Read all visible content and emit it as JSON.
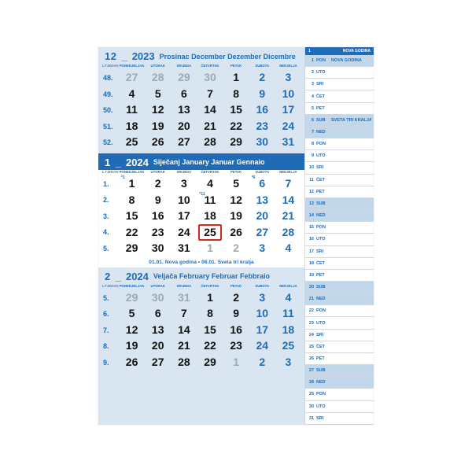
{
  "calendar": {
    "dow_labels": [
      "1.TJEDAN",
      "PONEDJELJAK",
      "UTORAK",
      "SRIJEDA",
      "ČETVRTAK",
      "PETAK",
      "SUBOTA",
      "NEDJELJA"
    ],
    "months": [
      {
        "num": "12",
        "sep": "_",
        "year": "2023",
        "names": "Prosinac December Dezember Dicembre",
        "main": false,
        "weeks": [
          {
            "wk": "48.",
            "days": [
              {
                "n": "27",
                "cls": "other"
              },
              {
                "n": "28",
                "cls": "other"
              },
              {
                "n": "29",
                "cls": "other"
              },
              {
                "n": "30",
                "cls": "other"
              },
              {
                "n": "1",
                "cls": ""
              },
              {
                "n": "2",
                "cls": "sat"
              },
              {
                "n": "3",
                "cls": "sun"
              }
            ]
          },
          {
            "wk": "49.",
            "days": [
              {
                "n": "4"
              },
              {
                "n": "5"
              },
              {
                "n": "6"
              },
              {
                "n": "7"
              },
              {
                "n": "8"
              },
              {
                "n": "9",
                "cls": "sat"
              },
              {
                "n": "10",
                "cls": "sun"
              }
            ]
          },
          {
            "wk": "50.",
            "days": [
              {
                "n": "11"
              },
              {
                "n": "12"
              },
              {
                "n": "13"
              },
              {
                "n": "14"
              },
              {
                "n": "15"
              },
              {
                "n": "16",
                "cls": "sat"
              },
              {
                "n": "17",
                "cls": "sun"
              }
            ]
          },
          {
            "wk": "51.",
            "days": [
              {
                "n": "18"
              },
              {
                "n": "19"
              },
              {
                "n": "20"
              },
              {
                "n": "21"
              },
              {
                "n": "22"
              },
              {
                "n": "23",
                "cls": "sat"
              },
              {
                "n": "24",
                "cls": "sun"
              }
            ]
          },
          {
            "wk": "52.",
            "days": [
              {
                "n": "25"
              },
              {
                "n": "26"
              },
              {
                "n": "27"
              },
              {
                "n": "28"
              },
              {
                "n": "29"
              },
              {
                "n": "30",
                "cls": "sat"
              },
              {
                "n": "31",
                "cls": "sun"
              }
            ]
          }
        ]
      },
      {
        "num": "1",
        "sep": "_",
        "year": "2024",
        "names": "Siječanj January Januar Gennaio",
        "main": true,
        "weeks": [
          {
            "wk": "1.",
            "days": [
              {
                "n": "1",
                "sup": "*1"
              },
              {
                "n": "2"
              },
              {
                "n": "3"
              },
              {
                "n": "4"
              },
              {
                "n": "5"
              },
              {
                "n": "6",
                "cls": "sat",
                "sup": "*6"
              },
              {
                "n": "7",
                "cls": "sun"
              }
            ]
          },
          {
            "wk": "2.",
            "days": [
              {
                "n": "8"
              },
              {
                "n": "9"
              },
              {
                "n": "10"
              },
              {
                "n": "11",
                "sup": "*11"
              },
              {
                "n": "12"
              },
              {
                "n": "13",
                "cls": "sat"
              },
              {
                "n": "14",
                "cls": "sun"
              }
            ]
          },
          {
            "wk": "3.",
            "days": [
              {
                "n": "15"
              },
              {
                "n": "16"
              },
              {
                "n": "17"
              },
              {
                "n": "18"
              },
              {
                "n": "19"
              },
              {
                "n": "20",
                "cls": "sat"
              },
              {
                "n": "21",
                "cls": "sun"
              }
            ]
          },
          {
            "wk": "4.",
            "days": [
              {
                "n": "22"
              },
              {
                "n": "23"
              },
              {
                "n": "24"
              },
              {
                "n": "25",
                "today": true
              },
              {
                "n": "26"
              },
              {
                "n": "27",
                "cls": "sat"
              },
              {
                "n": "28",
                "cls": "sun"
              }
            ]
          },
          {
            "wk": "5.",
            "days": [
              {
                "n": "29"
              },
              {
                "n": "30"
              },
              {
                "n": "31"
              },
              {
                "n": "1",
                "cls": "other"
              },
              {
                "n": "2",
                "cls": "other"
              },
              {
                "n": "3",
                "cls": "other sat"
              },
              {
                "n": "4",
                "cls": "other sun"
              }
            ]
          }
        ],
        "holidays": "01.01. Nova godina • 06.01. Sveta tri kralja"
      },
      {
        "num": "2",
        "sep": "_",
        "year": "2024",
        "names": "Veljača February Februar Febbraio",
        "main": false,
        "weeks": [
          {
            "wk": "5.",
            "days": [
              {
                "n": "29",
                "cls": "other"
              },
              {
                "n": "30",
                "cls": "other"
              },
              {
                "n": "31",
                "cls": "other"
              },
              {
                "n": "1"
              },
              {
                "n": "2"
              },
              {
                "n": "3",
                "cls": "sat"
              },
              {
                "n": "4",
                "cls": "sun"
              }
            ]
          },
          {
            "wk": "6.",
            "days": [
              {
                "n": "5"
              },
              {
                "n": "6"
              },
              {
                "n": "7"
              },
              {
                "n": "8"
              },
              {
                "n": "9"
              },
              {
                "n": "10",
                "cls": "sat"
              },
              {
                "n": "11",
                "cls": "sun"
              }
            ]
          },
          {
            "wk": "7.",
            "days": [
              {
                "n": "12"
              },
              {
                "n": "13"
              },
              {
                "n": "14"
              },
              {
                "n": "15"
              },
              {
                "n": "16"
              },
              {
                "n": "17",
                "cls": "sat"
              },
              {
                "n": "18",
                "cls": "sun"
              }
            ]
          },
          {
            "wk": "8.",
            "days": [
              {
                "n": "19"
              },
              {
                "n": "20"
              },
              {
                "n": "21"
              },
              {
                "n": "22"
              },
              {
                "n": "23"
              },
              {
                "n": "24",
                "cls": "sat"
              },
              {
                "n": "25",
                "cls": "sun"
              }
            ]
          },
          {
            "wk": "9.",
            "days": [
              {
                "n": "26"
              },
              {
                "n": "27"
              },
              {
                "n": "28"
              },
              {
                "n": "29"
              },
              {
                "n": "1",
                "cls": "other"
              },
              {
                "n": "2",
                "cls": "other sat"
              },
              {
                "n": "3",
                "cls": "other sun"
              }
            ]
          }
        ]
      }
    ]
  },
  "side": {
    "head_left": "1",
    "head_right": "NOVA GODINA",
    "rows": [
      {
        "dn": "1",
        "dw": "PON",
        "note": "NOVA GODINA",
        "hl": true
      },
      {
        "dn": "2",
        "dw": "UTO"
      },
      {
        "dn": "3",
        "dw": "SRI"
      },
      {
        "dn": "4",
        "dw": "ČET"
      },
      {
        "dn": "5",
        "dw": "PET"
      },
      {
        "dn": "6",
        "dw": "SUB",
        "note": "SVETA TRI KRALJA",
        "hl": true
      },
      {
        "dn": "7",
        "dw": "NED",
        "hl": true
      },
      {
        "dn": "8",
        "dw": "PON"
      },
      {
        "dn": "9",
        "dw": "UTO"
      },
      {
        "dn": "10",
        "dw": "SRI"
      },
      {
        "dn": "11",
        "dw": "ČET"
      },
      {
        "dn": "12",
        "dw": "PET"
      },
      {
        "dn": "13",
        "dw": "SUB",
        "hl": true
      },
      {
        "dn": "14",
        "dw": "NED",
        "hl": true
      },
      {
        "dn": "15",
        "dw": "PON"
      },
      {
        "dn": "16",
        "dw": "UTO"
      },
      {
        "dn": "17",
        "dw": "SRI"
      },
      {
        "dn": "18",
        "dw": "ČET"
      },
      {
        "dn": "19",
        "dw": "PET"
      },
      {
        "dn": "20",
        "dw": "SUB",
        "hl": true
      },
      {
        "dn": "21",
        "dw": "NED",
        "hl": true
      },
      {
        "dn": "22",
        "dw": "PON"
      },
      {
        "dn": "23",
        "dw": "UTO"
      },
      {
        "dn": "24",
        "dw": "SRI"
      },
      {
        "dn": "25",
        "dw": "ČET"
      },
      {
        "dn": "26",
        "dw": "PET"
      },
      {
        "dn": "27",
        "dw": "SUB",
        "hl": true
      },
      {
        "dn": "28",
        "dw": "NED",
        "hl": true
      },
      {
        "dn": "29",
        "dw": "PON"
      },
      {
        "dn": "30",
        "dw": "UTO"
      },
      {
        "dn": "31",
        "dw": "SRI"
      }
    ]
  }
}
